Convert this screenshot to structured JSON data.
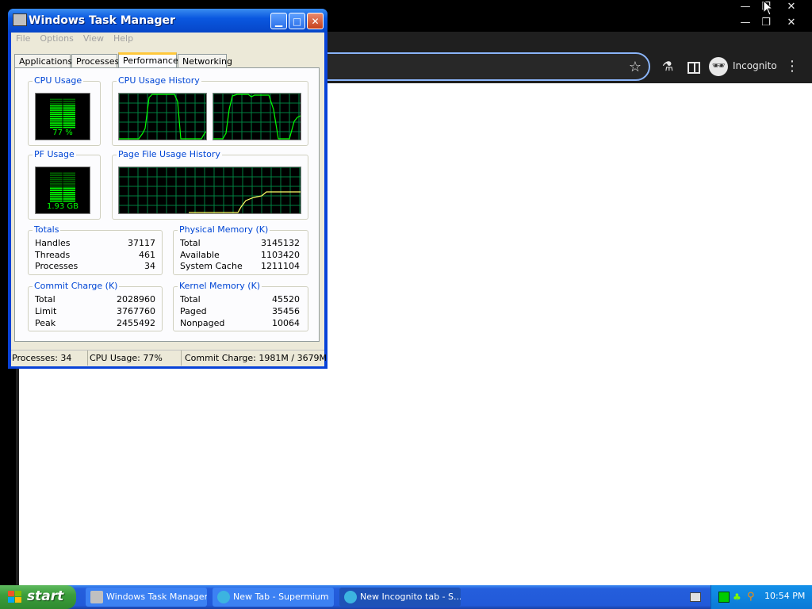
{
  "browser": {
    "profile_label": "Incognito",
    "icons": {
      "star": "star-icon",
      "flask": "flask-icon",
      "side_panel": "side-panel-icon",
      "incognito": "incognito-icon",
      "menu": "more-vert-icon"
    },
    "window_controls": [
      "—",
      "❐",
      "✕"
    ]
  },
  "outer_window_controls": [
    "—",
    "❐",
    "✕"
  ],
  "task_manager": {
    "title": "Windows Task Manager",
    "menu": [
      "File",
      "Options",
      "View",
      "Help"
    ],
    "tabs": [
      "Applications",
      "Processes",
      "Performance",
      "Networking"
    ],
    "active_tab": "Performance",
    "cpu_usage": {
      "label": "CPU Usage",
      "value": "77 %",
      "level": 0.77
    },
    "cpu_history": {
      "label": "CPU Usage History"
    },
    "pf_usage": {
      "label": "PF Usage",
      "value": "1.93 GB",
      "level": 0.52
    },
    "pf_history": {
      "label": "Page File Usage History"
    },
    "totals": {
      "label": "Totals",
      "rows": [
        {
          "k": "Handles",
          "v": "37117"
        },
        {
          "k": "Threads",
          "v": "461"
        },
        {
          "k": "Processes",
          "v": "34"
        }
      ]
    },
    "physical_memory": {
      "label": "Physical Memory (K)",
      "rows": [
        {
          "k": "Total",
          "v": "3145132"
        },
        {
          "k": "Available",
          "v": "1103420"
        },
        {
          "k": "System Cache",
          "v": "1211104"
        }
      ]
    },
    "commit_charge": {
      "label": "Commit Charge (K)",
      "rows": [
        {
          "k": "Total",
          "v": "2028960"
        },
        {
          "k": "Limit",
          "v": "3767760"
        },
        {
          "k": "Peak",
          "v": "2455492"
        }
      ]
    },
    "kernel_memory": {
      "label": "Kernel Memory (K)",
      "rows": [
        {
          "k": "Total",
          "v": "45520"
        },
        {
          "k": "Paged",
          "v": "35456"
        },
        {
          "k": "Nonpaged",
          "v": "10064"
        }
      ]
    },
    "status": {
      "processes": "Processes: 34",
      "cpu": "CPU Usage: 77%",
      "commit": "Commit Charge: 1981M / 3679M"
    }
  },
  "taskbar": {
    "start_label": "start",
    "tasks": [
      {
        "label": "Windows Task Manager",
        "icon": "task-manager-icon"
      },
      {
        "label": "New Tab - Supermium",
        "icon": "browser-icon"
      },
      {
        "label": "New Incognito tab - S...",
        "icon": "browser-icon"
      }
    ],
    "clock": "10:54 PM"
  },
  "colors": {
    "graph_line": "#00ff00",
    "grid": "#008040",
    "pf_line": "#ffff66",
    "accent": "#0046d5"
  }
}
